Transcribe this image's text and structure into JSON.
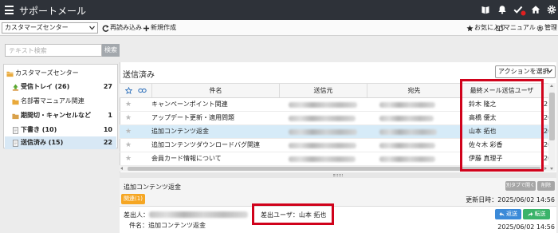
{
  "app": {
    "title": "サポートメール"
  },
  "toolbar": {
    "mailbox_select": "カスタマーズセンター",
    "reload_label": "再読み込み",
    "new_label": "新規作成",
    "favorites_label": "お気に入り",
    "manual_label": "マニュアル",
    "admin_label": "管理"
  },
  "sidebar": {
    "search_placeholder": "テキスト検索",
    "search_button": "検索",
    "root": "カスタマーズセンター",
    "items": [
      {
        "label": "受信トレイ (26)",
        "count": "27"
      },
      {
        "label": "名部署マニュアル関連",
        "count": ""
      },
      {
        "label": "期間切・キャンセルなど",
        "count": "1"
      },
      {
        "label": "下書き (10)",
        "count": "10"
      },
      {
        "label": "送信済み (15)",
        "count": "22",
        "selected": true
      }
    ]
  },
  "list": {
    "title": "送信済み",
    "action_select": "アクションを選択",
    "columns": {
      "subject": "件名",
      "from": "送信元",
      "to": "宛先",
      "last_user": "最終メール送信ユーザ"
    },
    "rows": [
      {
        "subject": "キャンペーンポイント関連",
        "last_user": "鈴木 隆之",
        "more": "2"
      },
      {
        "subject": "アップデート更新・適用問題",
        "last_user": "高橋 優太",
        "more": "20"
      },
      {
        "subject": "追加コンテンツ返金",
        "last_user": "山本 拓也",
        "more": "20",
        "selected": true
      },
      {
        "subject": "追加コンテンツダウンロードバグ関連",
        "last_user": "佐々木 彩香",
        "more": "20"
      },
      {
        "subject": "会員カード情報について",
        "last_user": "伊藤 真理子",
        "more": "20"
      }
    ]
  },
  "detail": {
    "title": "追加コンテンツ返金",
    "related_badge": "関連(1)",
    "open_tab_button": "別タブで開く",
    "delete_button": "削除",
    "updated": "更新日時：2025/06/02 14:56",
    "sender_label": "差出人：",
    "sender_user": "差出ユーザ：山本 拓也",
    "reply_button": "返送",
    "forward_button": "転送",
    "subject_line": "件名：追加コンテンツ返金",
    "date": "2025/06/02 14:56"
  },
  "colors": {
    "topbar": "#2e3239",
    "selected_row": "#d6ebf8",
    "highlight_box": "#d0021b",
    "related_badge": "#f5a623",
    "reply_button": "#3b8ad8",
    "forward_button": "#3bb36a",
    "notification_dot": "#e02020"
  },
  "icons": [
    "menu-icon",
    "book-icon",
    "bell-icon",
    "check-icon",
    "home-icon",
    "gear-icon",
    "refresh-icon",
    "plus-icon",
    "star-icon",
    "folder-icon",
    "inbox-icon",
    "document-icon",
    "link-icon",
    "reply-icon",
    "forward-icon"
  ]
}
